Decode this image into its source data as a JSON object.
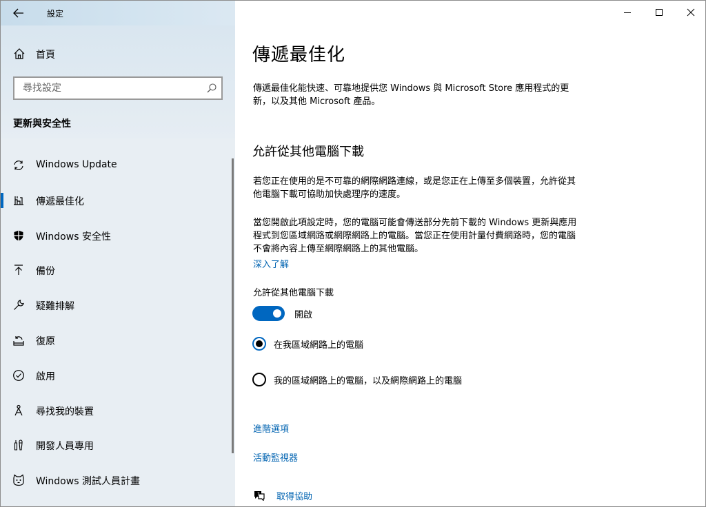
{
  "window": {
    "app_title": "設定",
    "controls": [
      "minimize-icon",
      "maximize-icon",
      "close-icon"
    ]
  },
  "sidebar": {
    "home_label": "首頁",
    "search_placeholder": "尋找設定",
    "section_title": "更新與安全性",
    "items": [
      {
        "label": "Windows Update",
        "icon": "sync-icon",
        "selected": false
      },
      {
        "label": "傳遞最佳化",
        "icon": "delivery-optimization-icon",
        "selected": true
      },
      {
        "label": "Windows 安全性",
        "icon": "shield-icon",
        "selected": false
      },
      {
        "label": "備份",
        "icon": "backup-arrow-icon",
        "selected": false
      },
      {
        "label": "疑難排解",
        "icon": "wrench-icon",
        "selected": false
      },
      {
        "label": "復原",
        "icon": "recovery-icon",
        "selected": false
      },
      {
        "label": "啟用",
        "icon": "activation-check-icon",
        "selected": false
      },
      {
        "label": "尋找我的裝置",
        "icon": "find-device-icon",
        "selected": false
      },
      {
        "label": "開發人員專用",
        "icon": "developer-tools-icon",
        "selected": false
      },
      {
        "label": "Windows 測試人員計畫",
        "icon": "insider-cat-icon",
        "selected": false
      }
    ]
  },
  "main": {
    "title": "傳遞最佳化",
    "description": "傳遞最佳化能快速、可靠地提供您 Windows 與 Microsoft Store 應用程式的更新，以及其他 Microsoft 產品。",
    "subheading": "允許從其他電腦下載",
    "paragraph1": "若您正在使用的是不可靠的網際網路連線，或是您正在上傳至多個裝置，允許從其他電腦下載可協助加快處理序的速度。",
    "paragraph2": "當您開啟此項設定時，您的電腦可能會傳送部分先前下載的 Windows 更新與應用程式到您區域網路或網際網路上的電腦。當您正在使用計量付費網路時，您的電腦不會將內容上傳至網際網路上的其他電腦。",
    "learn_more": "深入了解",
    "toggle_label": "允許從其他電腦下載",
    "toggle_state": "開啟",
    "toggle_on": true,
    "radio_options": [
      {
        "label": "在我區域網路上的電腦",
        "checked": true
      },
      {
        "label": "我的區域網路上的電腦，以及網際網路上的電腦",
        "checked": false
      }
    ],
    "advanced_options": "進階選項",
    "activity_monitor": "活動監視器",
    "get_help": "取得協助"
  },
  "colors": {
    "accent": "#0067c0",
    "link": "#0063b1",
    "sidebar_bg": "#e8eef3"
  }
}
